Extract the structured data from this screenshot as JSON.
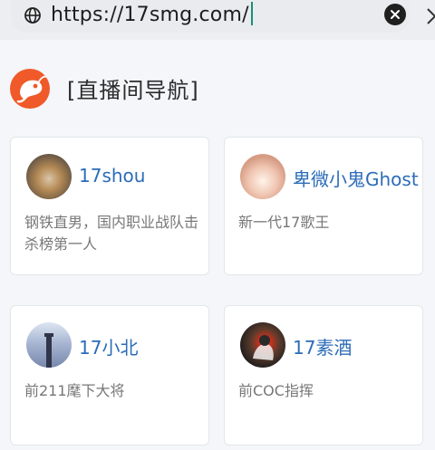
{
  "address_bar": {
    "url": "https://17smg.com/"
  },
  "section": {
    "title": "[直播间导航]"
  },
  "cards": [
    {
      "name": "17shou",
      "description": "钢铁直男，国内职业战队击杀榜第一人"
    },
    {
      "name": "卑微小鬼Ghost",
      "description": "新一代17歌王"
    },
    {
      "name": "17小北",
      "description": "前211麾下大将"
    },
    {
      "name": "17素酒",
      "description": "前COC指挥"
    }
  ],
  "colors": {
    "link": "#2c6cb8",
    "logo": "#f0592a",
    "caret": "#1a8f7c"
  },
  "icons": {
    "globe": "globe-icon",
    "clear": "clear-circle-icon",
    "close": "close-icon",
    "logo": "shrimp-logo-icon"
  }
}
